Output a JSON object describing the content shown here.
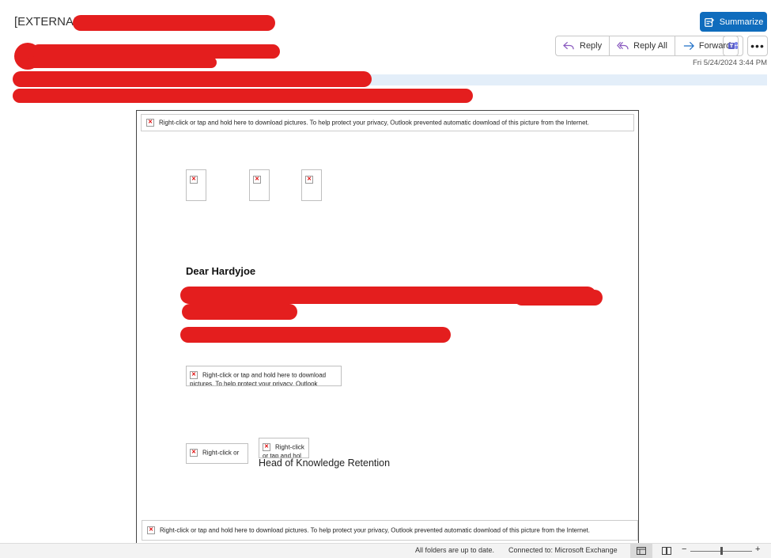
{
  "header": {
    "subject_prefix": "[EXTERNAL]",
    "summarize_label": "Summarize",
    "reply_label": "Reply",
    "reply_all_label": "Reply All",
    "forward_label": "Forward",
    "date": "Fri 5/24/2024 3:44 PM"
  },
  "body": {
    "blocked_notice": "Right-click or tap and hold here to download pictures. To help protect your privacy, Outlook prevented automatic download of this picture from the Internet.",
    "greeting": "Dear Hardyjoe",
    "blocked_short_1": "Right-click or tap and hold here to download pictures. To help protect your privacy, Outlook",
    "blocked_short_2": "Right-click or tap and hol",
    "blocked_short_3": "Right-click or",
    "signature_title": "Head of Knowledge Retention",
    "blocked_footer": "Right-click or tap and hold here to download pictures. To help protect your privacy, Outlook prevented automatic download of this picture from the Internet."
  },
  "status": {
    "sync": "All folders are up to date.",
    "connection": "Connected to: Microsoft Exchange",
    "zoom_minus": "−",
    "zoom_plus": "+"
  },
  "colors": {
    "accent": "#0f6cbd",
    "redaction": "#e41e1e"
  }
}
